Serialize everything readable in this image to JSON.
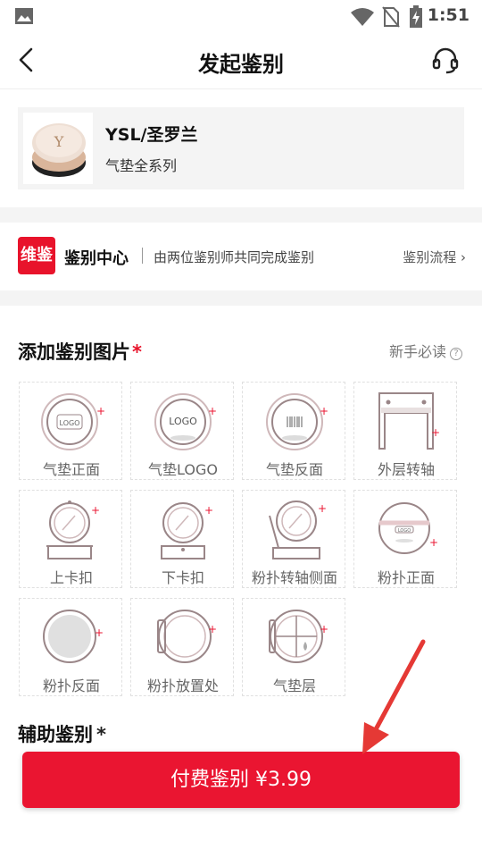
{
  "status_bar": {
    "time": "1:51"
  },
  "navbar": {
    "title": "发起鉴别"
  },
  "product": {
    "brand": "YSL/圣罗兰",
    "series": "气垫全系列"
  },
  "center": {
    "badge": "维鉴",
    "title": "鉴别中心",
    "description": "由两位鉴别师共同完成鉴别",
    "flow_link": "鉴别流程"
  },
  "photos": {
    "title": "添加鉴别图片",
    "required_mark": "*",
    "guide": "新手必读",
    "tiles": [
      {
        "label": "气垫正面",
        "icon": "cushion-front-icon"
      },
      {
        "label": "气垫LOGO",
        "icon": "cushion-logo-icon"
      },
      {
        "label": "气垫反面",
        "icon": "cushion-back-icon"
      },
      {
        "label": "外层转轴",
        "icon": "outer-hinge-icon"
      },
      {
        "label": "上卡扣",
        "icon": "upper-clasp-icon"
      },
      {
        "label": "下卡扣",
        "icon": "lower-clasp-icon"
      },
      {
        "label": "粉扑转轴侧面",
        "icon": "puff-hinge-side-icon"
      },
      {
        "label": "粉扑正面",
        "icon": "puff-front-icon"
      },
      {
        "label": "粉扑反面",
        "icon": "puff-back-icon"
      },
      {
        "label": "粉扑放置处",
        "icon": "puff-holder-icon"
      },
      {
        "label": "气垫层",
        "icon": "cushion-layer-icon"
      }
    ],
    "logo_text": "LOGO"
  },
  "aux": {
    "title": "辅助鉴别",
    "required_mark": "*"
  },
  "pay_button": {
    "label": "付费鉴别 ¥3.99"
  },
  "colors": {
    "accent": "#ea1531",
    "arrow": "#e53935"
  }
}
